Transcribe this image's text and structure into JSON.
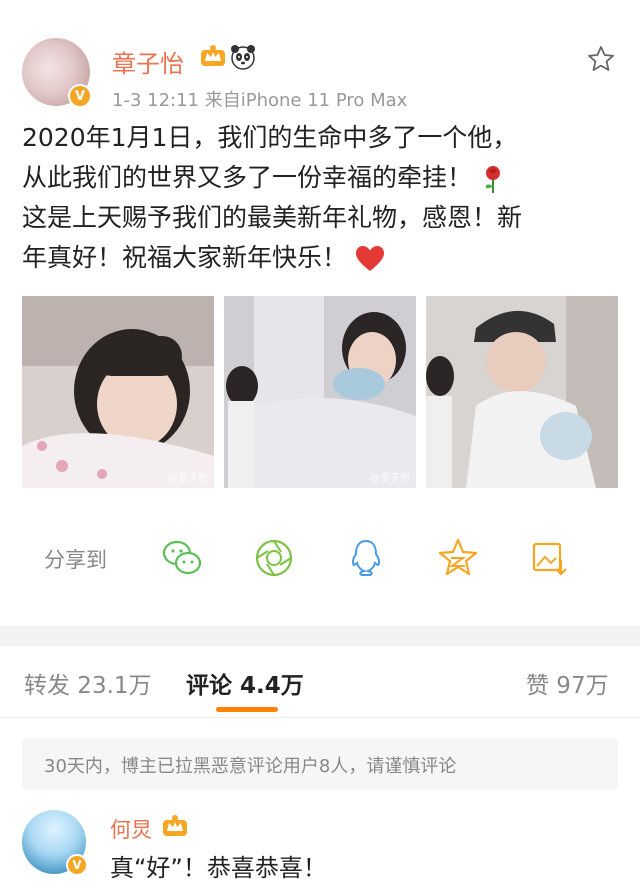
{
  "post": {
    "author": "章子怡",
    "meta": "1-3 12:11  来自iPhone 11 Pro Max",
    "lines": [
      "2020年1月1日，我们的生命中多了一个他，",
      "从此我们的世界又多了一份幸福的牵挂！",
      "这是上天赐予我们的最美新年礼物，感恩！新",
      "年真好！祝福大家新年快乐！"
    ],
    "emojis": [
      "rose-emoji",
      "red-heart-emoji"
    ],
    "watermarks": [
      "@章子怡",
      "@章子怡"
    ]
  },
  "share": {
    "label": "分享到",
    "targets": [
      "wechat-icon",
      "moments-icon",
      "qq-icon",
      "qzone-icon",
      "save-image-icon"
    ]
  },
  "tabs": {
    "repost": "转发 23.1万",
    "comments": "评论 4.4万",
    "likes": "赞 97万"
  },
  "notice": "30天内，博主已拉黑恶意评论用户8人，请谨慎评论",
  "comment": {
    "author": "何炅",
    "text": "真“好”！恭喜恭喜！"
  },
  "colors": {
    "accent": "#eb7350",
    "tab_indicator": "#ff8200",
    "share_green": "#5cc055",
    "share_lime": "#7dc243",
    "share_blue": "#4a9be6",
    "share_gold": "#f5a623"
  }
}
